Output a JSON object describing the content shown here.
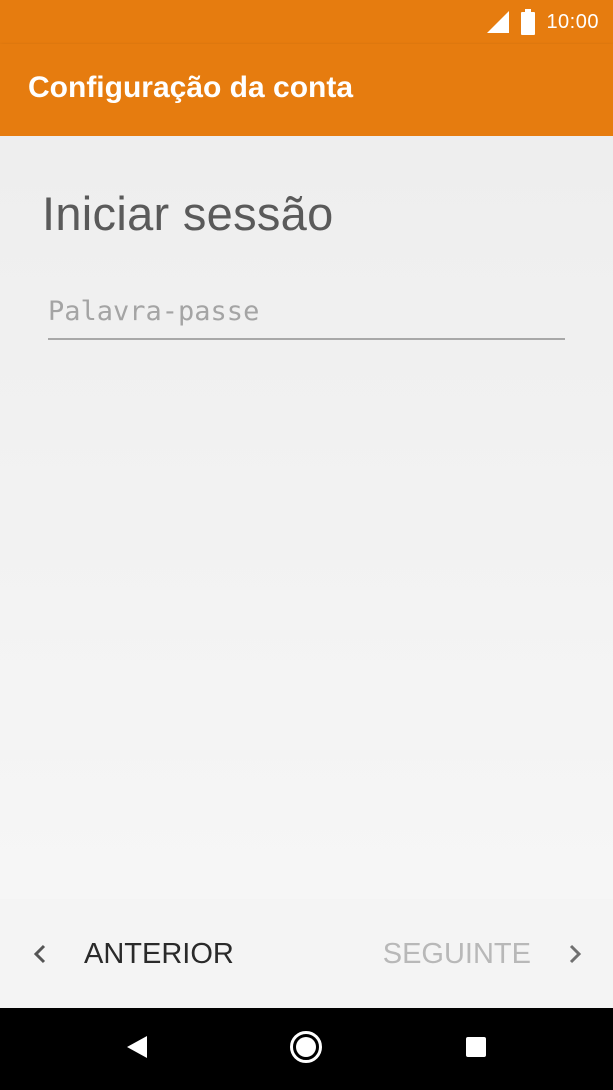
{
  "status_bar": {
    "time": "10:00",
    "icons": [
      "signal-icon",
      "battery-icon"
    ]
  },
  "app_bar": {
    "title": "Configuração da conta"
  },
  "page": {
    "heading": "Iniciar sessão",
    "password_field": {
      "value": "",
      "placeholder": "Palavra-passe"
    }
  },
  "bottom_nav": {
    "back_label": "ANTERIOR",
    "next_label": "SEGUINTE",
    "icons": [
      "chevron-left-icon",
      "chevron-right-icon"
    ]
  },
  "system_nav": {
    "icons": [
      "back-triangle-icon",
      "home-circle-icon",
      "recents-square-icon"
    ]
  },
  "colors": {
    "accent": "#e67c0f",
    "background": "#f1f1f1",
    "disabled_text": "#b8b8b8",
    "primary_text": "#2a2a2a"
  }
}
